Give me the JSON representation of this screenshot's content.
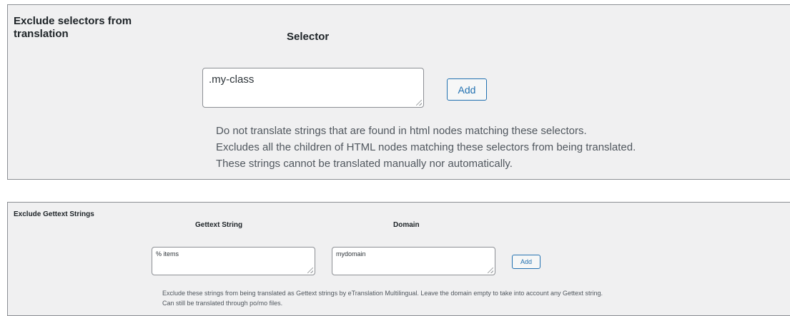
{
  "section1": {
    "heading_line1": "Exclude selectors from",
    "heading_line2": "translation",
    "column_label": "Selector",
    "input_value": ".my-class",
    "add_label": "Add",
    "desc_line1": "Do not translate strings that are found in html nodes matching these selectors.",
    "desc_line2": "Excludes all the children of HTML nodes matching these selectors from being translated.",
    "desc_line3": "These strings cannot be translated manually nor automatically."
  },
  "section2": {
    "heading": "Exclude Gettext Strings",
    "col_string": "Gettext String",
    "col_domain": "Domain",
    "string_value": "% items",
    "domain_value": "mydomain",
    "add_label": "Add",
    "desc_line1": "Exclude these strings from being translated as Gettext strings by eTranslation Multilingual. Leave the domain empty to take into account any Gettext string.",
    "desc_line2": "Can still be translated through po/mo files."
  }
}
